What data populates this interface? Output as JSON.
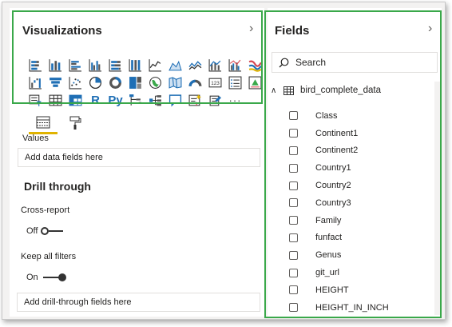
{
  "visualizations": {
    "title": "Visualizations",
    "rows": [
      [
        "stacked-bar-chart",
        "stacked-column-chart",
        "clustered-bar-chart",
        "clustered-column-chart",
        "100-stacked-bar-chart",
        "100-stacked-column-chart",
        "line-chart",
        "area-chart",
        "stacked-area-chart",
        "line-and-stacked-column-chart",
        "line-and-clustered-column-chart",
        "ribbon-chart"
      ],
      [
        "waterfall-chart",
        "funnel-chart",
        "scatter-chart",
        "pie-chart",
        "donut-chart",
        "treemap",
        "map",
        "filled-map",
        "gauge",
        "card",
        "multi-row-card",
        "kpi"
      ],
      [
        "slicer",
        "table",
        "matrix",
        "r-script-visual",
        "python-visual",
        "key-influencers",
        "decomposition-tree",
        "qa-visual",
        "smart-narrative",
        "paginated-report",
        "more-visuals"
      ]
    ],
    "r_label": "R",
    "py_label": "Py",
    "more_label": "···",
    "card_label": "123"
  },
  "well": {
    "values_label": "Values",
    "values_placeholder": "Add data fields here",
    "drill_title": "Drill through",
    "cross_report_label": "Cross-report",
    "cross_report_state": "Off",
    "keep_filters_label": "Keep all filters",
    "keep_filters_state": "On",
    "drill_placeholder": "Add drill-through fields here"
  },
  "fields": {
    "title": "Fields",
    "search_placeholder": "Search",
    "table_name": "bird_complete_data",
    "items": [
      "Class",
      "Continent1",
      "Continent2",
      "Country1",
      "Country2",
      "Country3",
      "Family",
      "funfact",
      "Genus",
      "git_url",
      "HEIGHT",
      "HEIGHT_IN_INCH"
    ]
  },
  "colors": {
    "highlight": "#3aa84a",
    "accent_underline": "#e0b300",
    "icon_blue": "#1f6fb5"
  }
}
